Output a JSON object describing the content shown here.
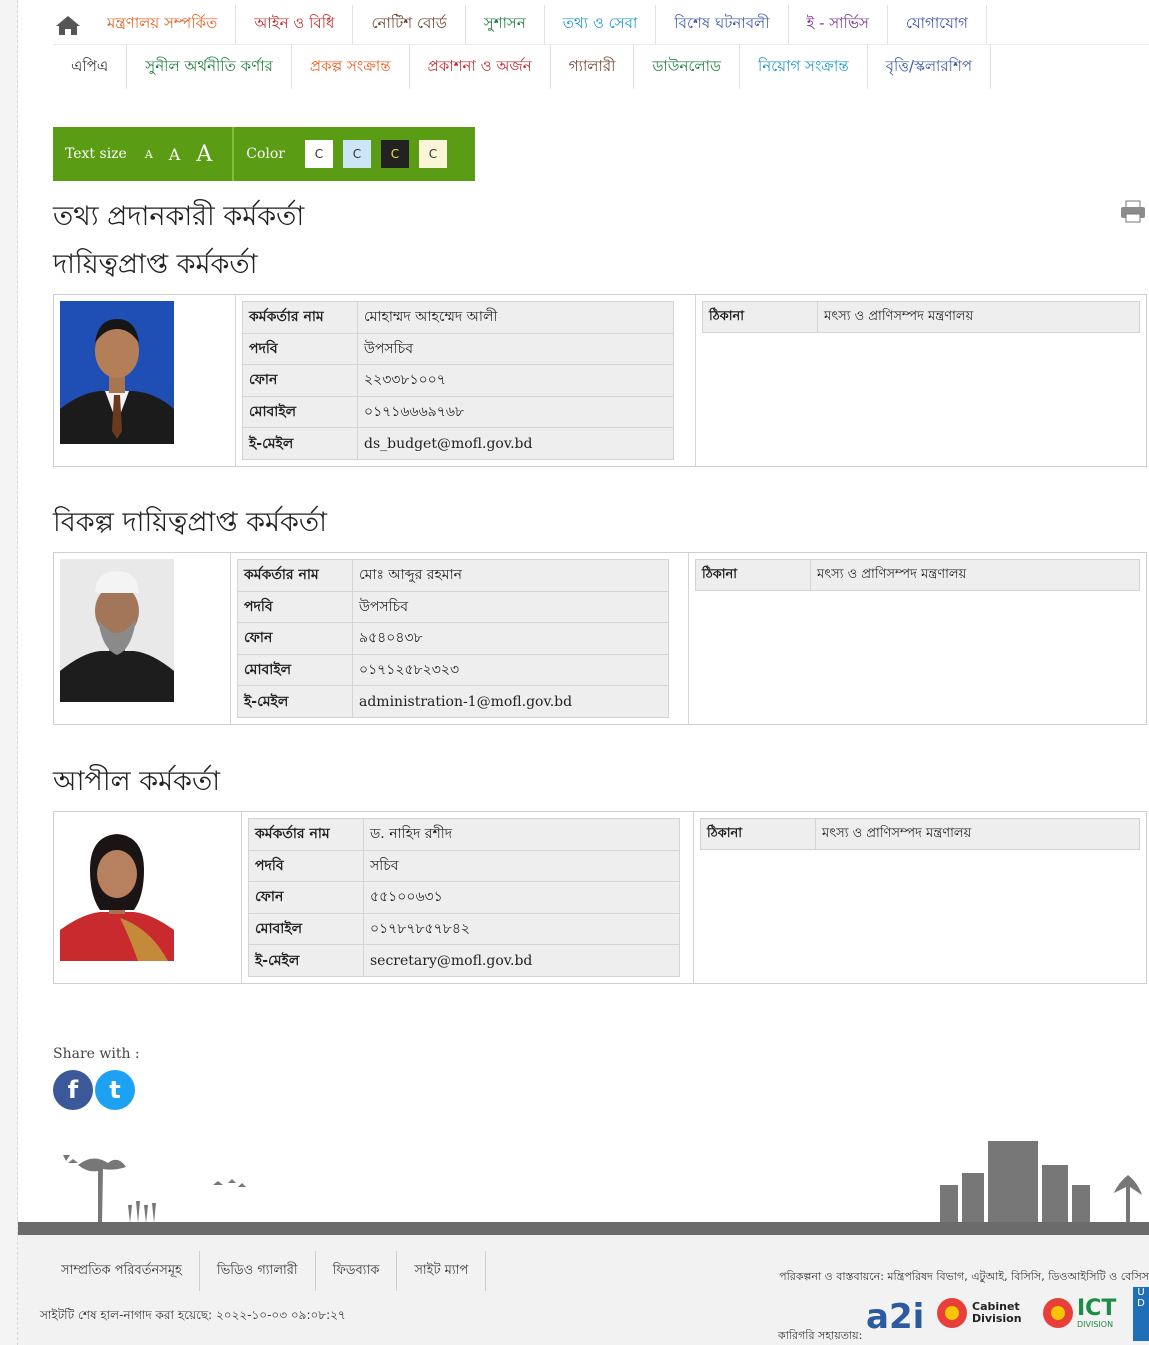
{
  "nav": {
    "row1": [
      {
        "label": "মন্ত্রণালয় সম্পর্কিত",
        "color": "#e85c1d"
      },
      {
        "label": "আইন ও বিধি",
        "color": "#c0282d"
      },
      {
        "label": "নোটিশ বোর্ড",
        "color": "#6a3d2a"
      },
      {
        "label": "সুশাসন",
        "color": "#1a7a3a"
      },
      {
        "label": "তথ্য ও সেবা",
        "color": "#1996c8"
      },
      {
        "label": "বিশেষ ঘটনাবলী",
        "color": "#3d5aa8"
      },
      {
        "label": "ই - সার্ভিস",
        "color": "#7b2e8a"
      },
      {
        "label": "যোগাযোগ",
        "color": "#3b4ea0"
      }
    ],
    "row2": [
      {
        "label": "এপিএ",
        "color": "#333333"
      },
      {
        "label": "সুনীল অর্থনীতি কর্ণার",
        "color": "#1a7a3a"
      },
      {
        "label": "প্রকল্প সংক্রান্ত",
        "color": "#e85c1d"
      },
      {
        "label": "প্রকাশনা ও অর্জন",
        "color": "#c0282d"
      },
      {
        "label": "গ্যালারী",
        "color": "#6a3d2a"
      },
      {
        "label": "ডাউনলোড",
        "color": "#1a7a3a"
      },
      {
        "label": "নিয়োগ সংক্রান্ত",
        "color": "#1996c8"
      },
      {
        "label": "বৃত্তি/স্কলারশিপ",
        "color": "#3d5aa8"
      }
    ]
  },
  "accessibility": {
    "text_size_label": "Text size",
    "size_small": "A",
    "size_medium": "A",
    "size_large": "A",
    "color_label": "Color",
    "swatch_label": "C",
    "swatches": [
      "#ffffff",
      "#cde6f7",
      "#222222",
      "#fbf5d8"
    ]
  },
  "page": {
    "title": "তথ্য প্রদানকারী কর্মকর্তা",
    "section1": "দায়িত্বপ্রাপ্ত কর্মকর্তা",
    "section2": "বিকল্প দায়িত্বপ্রাপ্ত কর্মকর্তা",
    "section3": "আপীল কর্মকর্তা"
  },
  "labels": {
    "name": "কর্মকর্তার নাম",
    "designation": "পদবি",
    "phone": "ফোন",
    "mobile": "মোবাইল",
    "email": "ই-মেইল",
    "address": "ঠিকানা"
  },
  "officers": [
    {
      "name": "মোহাম্মদ আহম্মেদ আলী",
      "designation": "উপসচিব",
      "phone": "২২৩৩৮১০০৭",
      "mobile": "০১৭১৬৬৬৯৭৬৮",
      "email": "ds_budget@mofl.gov.bd",
      "address": "মৎস্য ও প্রাণিসম্পদ মন্ত্রণালয়"
    },
    {
      "name": "মোঃ আব্দুর রহমান",
      "designation": "উপসচিব",
      "phone": "৯৫৪০৪৩৮",
      "mobile": "০১৭১২৫৮২৩২৩",
      "email": "administration-1@mofl.gov.bd",
      "address": "মৎস্য ও প্রাণিসম্পদ মন্ত্রণালয়"
    },
    {
      "name": "ড. নাহিদ রশীদ",
      "designation": "সচিব",
      "phone": "৫৫১০০৬৩১",
      "mobile": "০১৭৮৭৮৫৭৮৪২",
      "email": "secretary@mofl.gov.bd",
      "address": "মৎস্য ও প্রাণিসম্পদ মন্ত্রণালয়"
    }
  ],
  "share": {
    "label": "Share with :",
    "facebook": "f",
    "twitter": "t"
  },
  "footer": {
    "links": [
      "সাম্প্রতিক পরিবর্তনসমূহ",
      "ভিডিও গ্যালারী",
      "ফিডব্যাক",
      "সাইট ম্যাপ"
    ],
    "updated": "সাইটটি শেষ হাল-নাগাদ করা হয়েছে: ২০২২-১০-০৩ ০৯:০৮:২৭",
    "planning": "পরিকল্পনা ও বাস্তবায়নে: মন্ত্রিপরিষদ বিভাগ, এটুআই, বিসিসি, ডিওআইসিটি ও বেসিস",
    "tech_support": "কারিগরি সহায়তায়:",
    "a2i_logo": "a2i",
    "cabinet_logo": "Cabinet Division",
    "ict_logo": "ICT",
    "ict_sub": "DIVISION",
    "undp_logo": "U D"
  }
}
